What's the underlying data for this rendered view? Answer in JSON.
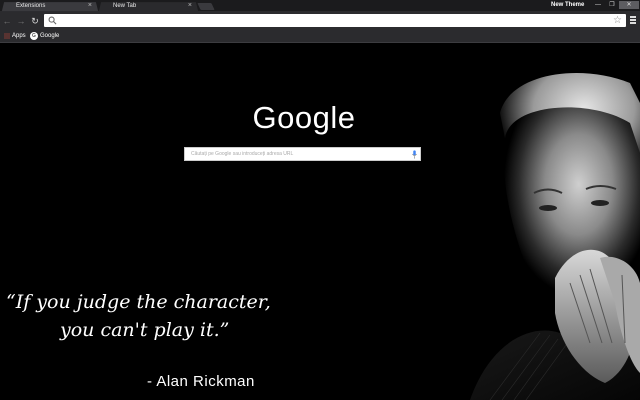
{
  "tabs": [
    {
      "label": "Extensions",
      "active": false
    },
    {
      "label": "New Tab",
      "active": true
    }
  ],
  "window": {
    "theme_label": "New Theme",
    "minimize_glyph": "—",
    "maximize_glyph": "❐",
    "close_glyph": "✕"
  },
  "toolbar": {
    "address_value": "",
    "icons": [
      "back-arrow-icon",
      "forward-arrow-icon",
      "reload-icon",
      "search-icon",
      "star-icon",
      "menu-icon"
    ]
  },
  "bookmarks": [
    {
      "label": "Apps",
      "icon": "apps-grid-icon"
    },
    {
      "label": "Google",
      "icon": "google-favicon-icon"
    }
  ],
  "newtab": {
    "logo_text": "Google",
    "search_placeholder": "Căutați pe Google sau introduceți adresa URL",
    "quote_line1": "“If you judge the character,",
    "quote_line2": "you can't play it.”",
    "author": "- Alan Rickman"
  },
  "colors": {
    "frame": "#1b1b1d",
    "toolbar": "#2b2b2e",
    "page_bg": "#000000",
    "text": "#ffffff"
  }
}
